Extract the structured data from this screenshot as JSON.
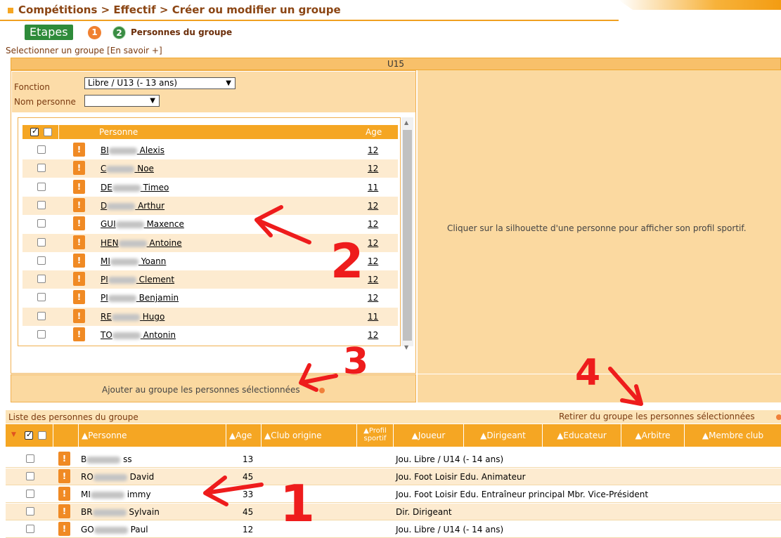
{
  "header": {
    "breadcrumb": "Compétitions > Effectif > Créer ou modifier un groupe",
    "etapes_label": "Etapes",
    "step1": "1",
    "step2": "2",
    "step2_label": "Personnes du groupe",
    "select_group_link": "Selectionner un groupe [En savoir +]"
  },
  "group": {
    "name": "U15",
    "fonction_label": "Fonction",
    "fonction_value": "Libre / U13 (- 13 ans)",
    "nom_label": "Nom personne",
    "nom_value": "",
    "profile_hint": "Cliquer sur la silhouette d'une personne pour afficher son profil sportif.",
    "add_label": "Ajouter au groupe les personnes sélectionnées"
  },
  "candidates": {
    "header_person": "Personne",
    "header_age": "Age",
    "rows": [
      {
        "prefix": "BI",
        "name": "Alexis",
        "age": "12"
      },
      {
        "prefix": "C",
        "name": "Noe",
        "age": "12"
      },
      {
        "prefix": "DE",
        "name": "Timeo",
        "age": "11"
      },
      {
        "prefix": "D",
        "name": "Arthur",
        "age": "12"
      },
      {
        "prefix": "GUI",
        "name": "Maxence",
        "age": "12"
      },
      {
        "prefix": "HEN",
        "name": "Antoine",
        "age": "12"
      },
      {
        "prefix": "MI",
        "name": "Yoann",
        "age": "12"
      },
      {
        "prefix": "PI",
        "name": "Clement",
        "age": "12"
      },
      {
        "prefix": "PI",
        "name": "Benjamin",
        "age": "12"
      },
      {
        "prefix": "RE",
        "name": "Hugo",
        "age": "11"
      },
      {
        "prefix": "TO",
        "name": "Antonin",
        "age": "12"
      }
    ]
  },
  "members": {
    "title": "Liste des personnes du groupe",
    "remove_label": "Retirer du groupe les personnes sélectionnées",
    "columns": {
      "person": "▲Personne",
      "age": "▲Age",
      "club": "▲Club origine",
      "profil_line1": "▲Profil",
      "profil_line2": "sportif",
      "joueur": "▲Joueur",
      "dirigeant": "▲Dirigeant",
      "educateur": "▲Educateur",
      "arbitre": "▲Arbitre",
      "membre": "▲Membre club"
    },
    "rows": [
      {
        "prefix": "B",
        "name": "ss",
        "age": "13",
        "role": "Jou. Libre / U14 (- 14 ans)"
      },
      {
        "prefix": "RO",
        "name": "David",
        "age": "45",
        "role": "Jou. Foot Loisir Edu. Animateur"
      },
      {
        "prefix": "MI",
        "name": "immy",
        "age": "33",
        "role": "Jou. Foot Loisir Edu. Entraîneur principal Mbr. Vice-Président"
      },
      {
        "prefix": "BR",
        "name": "Sylvain",
        "age": "45",
        "role": "Dir. Dirigeant"
      },
      {
        "prefix": "GO",
        "name": "Paul",
        "age": "12",
        "role": "Jou. Libre / U14 (- 14 ans)"
      }
    ]
  },
  "annotations": {
    "n1": "1",
    "n2": "2",
    "n3": "3",
    "n4": "4"
  },
  "colors": {
    "accent": "#f5a623",
    "panel": "#fbd9a0",
    "green": "#2e8b3a",
    "annotation": "#ee1c1c"
  }
}
